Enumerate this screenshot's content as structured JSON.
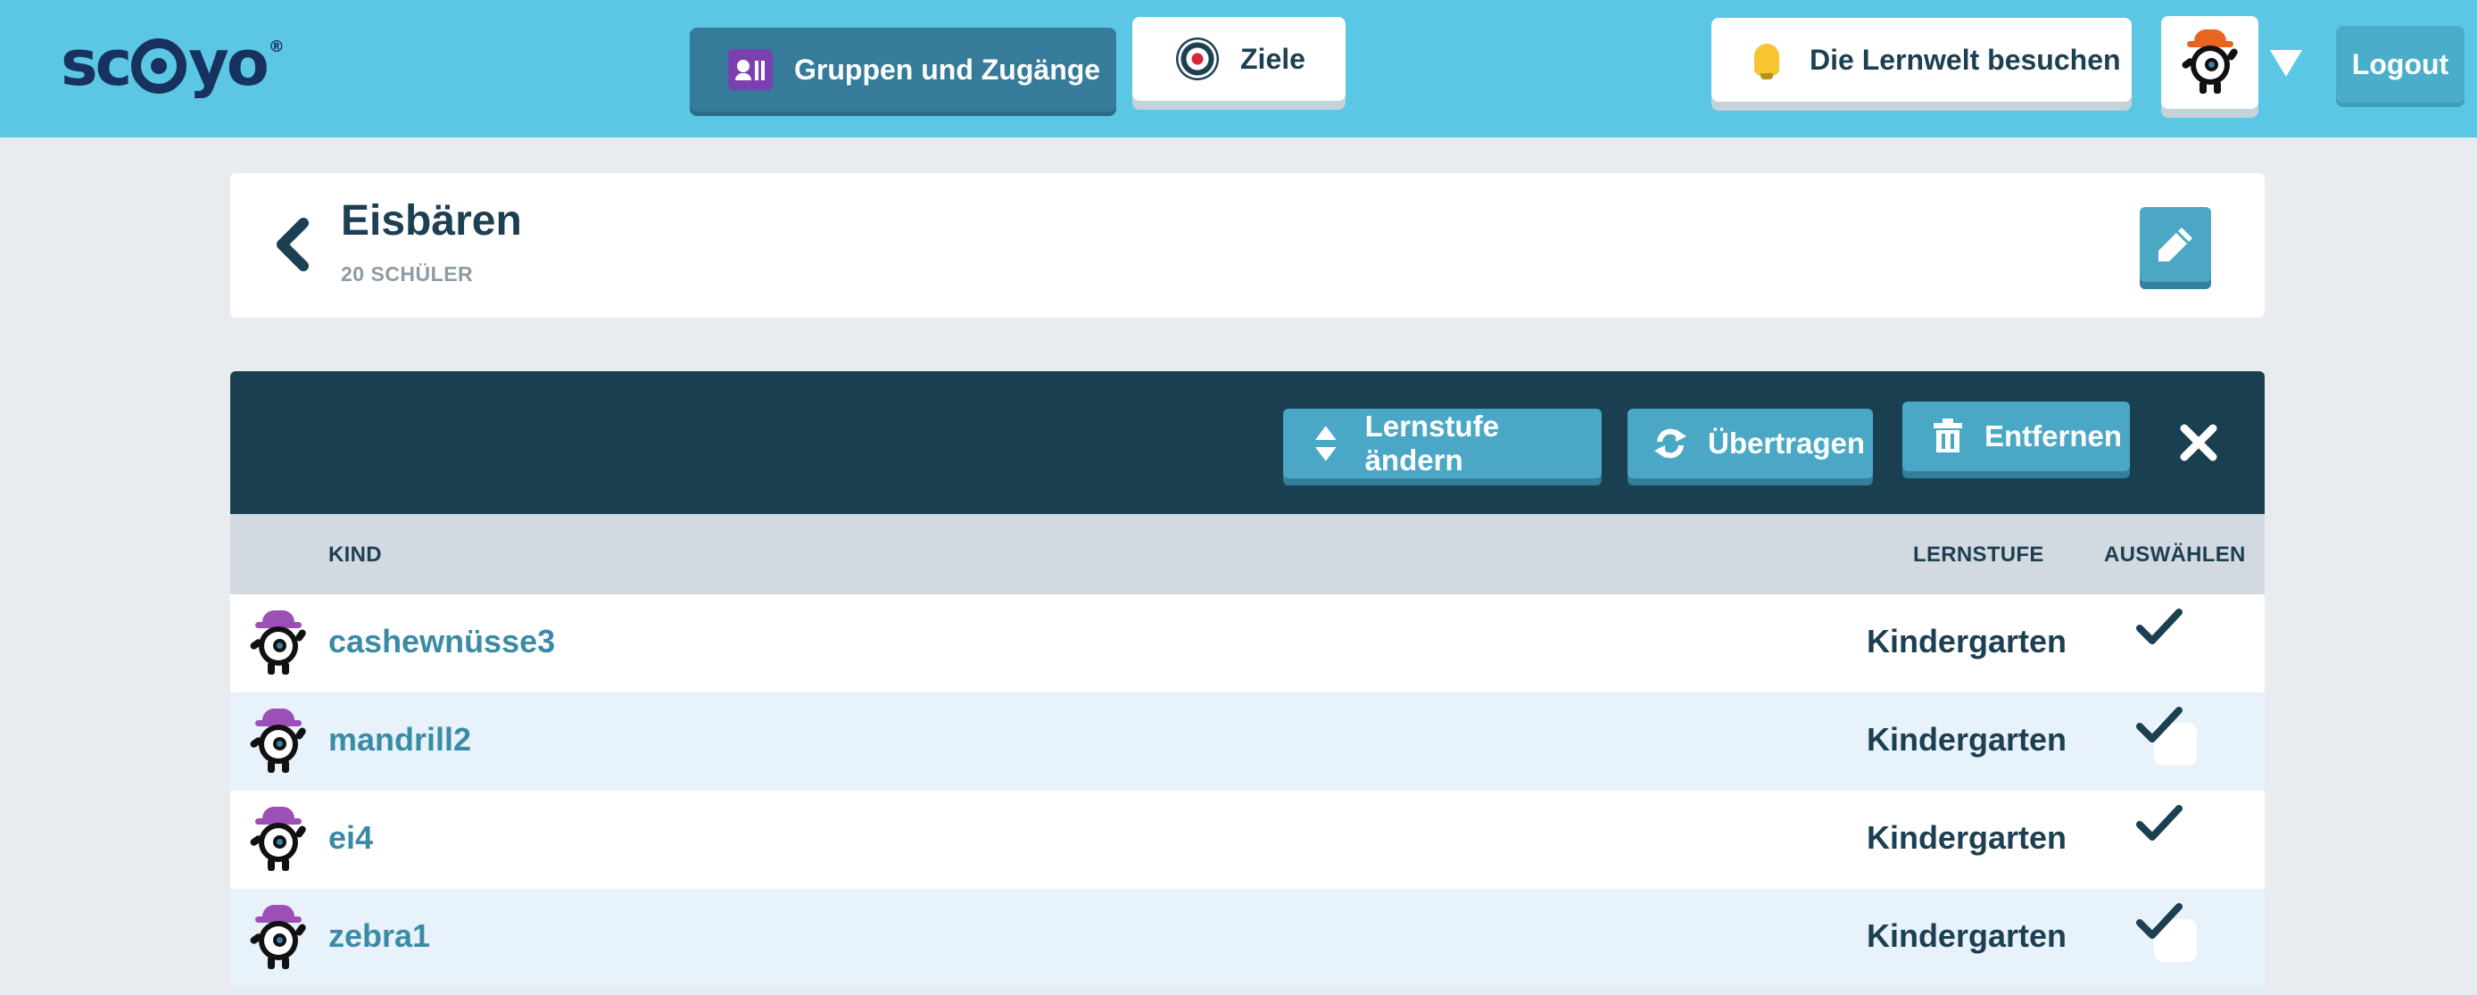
{
  "header": {
    "logo": "scoyo",
    "nav_groups_label": "Gruppen und Zugänge",
    "nav_goals_label": "Ziele",
    "nav_lernwelt_label": "Die Lernwelt besuchen",
    "logout_label": "Logout"
  },
  "group": {
    "title": "Eisbären",
    "subtitle": "20 SCHÜLER"
  },
  "actions": {
    "lernstufe_label": "Lernstufe ändern",
    "uebertragen_label": "Übertragen",
    "entfernen_label": "Entfernen"
  },
  "table": {
    "columns": {
      "kind": "KIND",
      "lernstufe": "LERNSTUFE",
      "auswaehlen": "AUSWÄHLEN"
    },
    "rows": [
      {
        "name": "cashewnüsse3",
        "level": "Kindergarten",
        "selected": true
      },
      {
        "name": "mandrill2",
        "level": "Kindergarten",
        "selected": true
      },
      {
        "name": "ei4",
        "level": "Kindergarten",
        "selected": true
      },
      {
        "name": "zebra1",
        "level": "Kindergarten",
        "selected": true
      }
    ]
  },
  "colors": {
    "topbar": "#5bc7e5",
    "dark_navy": "#1a3f50",
    "accent_button": "#4aa8c6",
    "link_teal": "#3a8ba6"
  }
}
